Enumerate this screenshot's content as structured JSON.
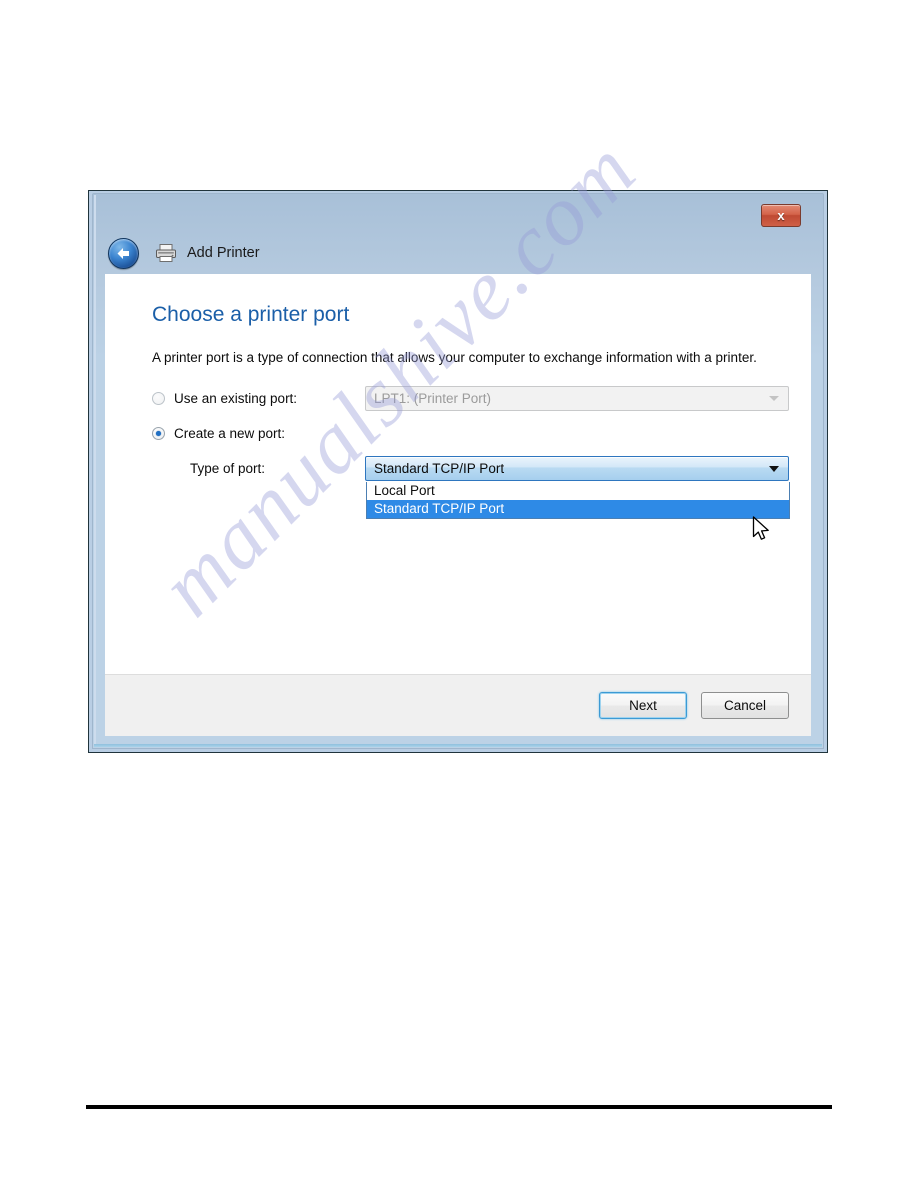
{
  "page": {
    "watermark_text": "manualshive.com"
  },
  "window": {
    "close_label": "x",
    "nav_title": "Add Printer",
    "back_icon": "back-arrow-icon",
    "printer_icon": "printer-icon"
  },
  "main": {
    "heading": "Choose a printer port",
    "intro": "A printer port is a type of connection that allows your computer to exchange information with a printer.",
    "existing_port": {
      "radio_label": "Use an existing port:",
      "checked": false,
      "value": "LPT1: (Printer Port)",
      "disabled": true
    },
    "new_port": {
      "radio_label": "Create a new port:",
      "checked": true
    },
    "type_of_port": {
      "label": "Type of port:",
      "value": "Standard TCP/IP Port",
      "options": [
        {
          "label": "Local Port",
          "selected": false
        },
        {
          "label": "Standard TCP/IP Port",
          "selected": true
        }
      ]
    }
  },
  "footer": {
    "next_label": "Next",
    "cancel_label": "Cancel"
  },
  "colors": {
    "heading": "#1b5fa8",
    "highlight": "#2e8ae6",
    "close_button": "#c4503a",
    "titlebar": "#bcd2e6"
  }
}
